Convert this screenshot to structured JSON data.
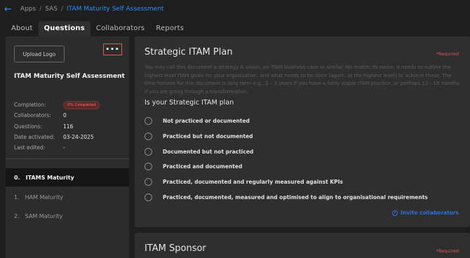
{
  "breadcrumb": {
    "back_icon": "arrow-left-icon",
    "items": [
      "Apps",
      "SAS"
    ],
    "separator": "/",
    "current": "ITAM Maturity Self Assessment"
  },
  "tabs": [
    "About",
    "Questions",
    "Collaborators",
    "Reports"
  ],
  "active_tab": "Questions",
  "sidebar": {
    "upload_label": "Upload Logo",
    "more_label": "•••",
    "title": "ITAM Maturity Self Assessment",
    "info": [
      {
        "label": "Completion:",
        "value": "0% Completed"
      },
      {
        "label": "Collaborators:",
        "value": "0"
      },
      {
        "label": "Questions:",
        "value": "116"
      },
      {
        "label": "Date activated:",
        "value": "03-24-2025"
      },
      {
        "label": "Last edited:",
        "value": "-"
      }
    ],
    "sections": [
      {
        "num": "0.",
        "label": "ITAMS Maturity"
      },
      {
        "num": "1.",
        "label": "HAM Maturity"
      },
      {
        "num": "2.",
        "label": "SAM Maturity"
      }
    ]
  },
  "card1": {
    "title": "Strategic ITAM Plan",
    "required": "*Required",
    "description": "You may call this document a strategy & vision, an ITAM business case or similar. No matter its name, it needs to outline the highest level ITAM goals for your organisation, and what needs to be done (again, at the highest level) to achieve these. The time horizon for this document is long term e.g., 2 – 3 years if you have a fairly stable ITAM practice, or perhaps 12 - 18 months if you are going through a transformation.",
    "question": "Is your Strategic ITAM plan",
    "options": [
      "Not practiced or documented",
      "Practiced but not documented",
      "Documented but not practiced",
      "Practiced and documented",
      "Practiced, documented and regularly measured against KPIs",
      "Practiced, documented, measured and optimised to align to organisational requirements"
    ],
    "invite_label": "Invite collaborators"
  },
  "card2": {
    "title": "ITAM Sponsor",
    "required": "*Required"
  },
  "colors": {
    "accent": "#2f8fff",
    "required": "#e05555",
    "background": "#1e1e1e",
    "card": "#2f2f2f"
  }
}
